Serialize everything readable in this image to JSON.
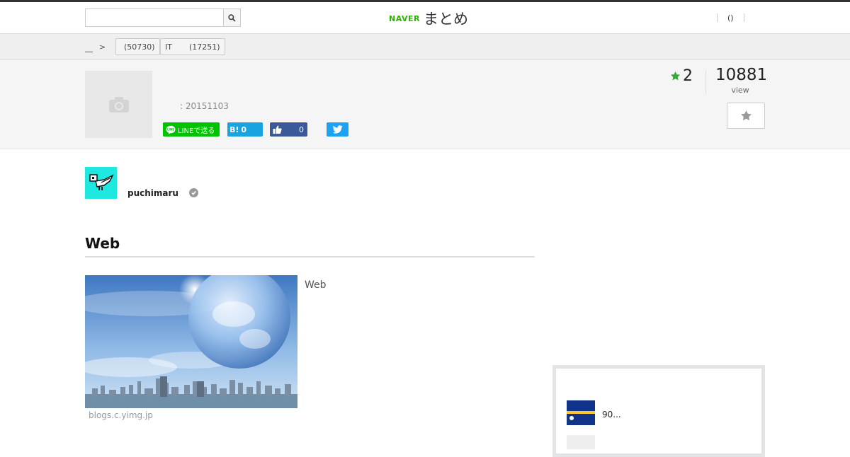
{
  "header": {
    "search": {
      "placeholder": "",
      "value": ""
    },
    "logo": {
      "brand": "NAVER",
      "name": "まとめ"
    },
    "links": [
      "()"
    ]
  },
  "breadcrumb": {
    "home": "__",
    "tags": [
      {
        "label": "",
        "count": "(50730)"
      },
      {
        "label": "IT",
        "count": "(17251)"
      }
    ]
  },
  "article": {
    "date": ": 20151103",
    "share": {
      "line_label": "LINEで送る",
      "hatena_label": "B!",
      "hatena_count": "0",
      "facebook_count": "0"
    },
    "favorites": "2",
    "views": "10881",
    "views_label": "view"
  },
  "author": {
    "name": "puchimaru"
  },
  "section": {
    "title": "Web",
    "image_caption": "Web",
    "image_source": "blogs.c.yimg.jp"
  },
  "sidebar": {
    "related": [
      {
        "title": "90..."
      }
    ]
  },
  "colors": {
    "naver_green": "#2db400",
    "line_green": "#00c300",
    "hatena_blue": "#19a3e1",
    "facebook_blue": "#3b5998",
    "twitter_blue": "#1da1f2",
    "star_green": "#3aa83a"
  }
}
